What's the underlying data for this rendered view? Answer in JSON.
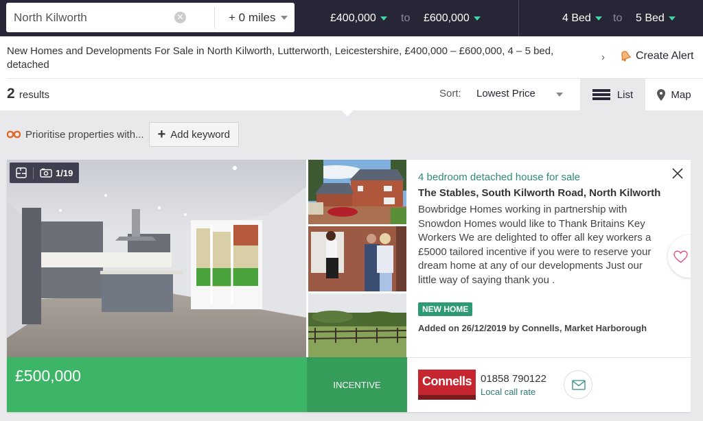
{
  "search": {
    "location_value": "North Kilworth",
    "radius": "+ 0 miles"
  },
  "filters": {
    "min_price": "£400,000",
    "max_price": "£600,000",
    "min_beds": "4 Bed",
    "max_beds": "5 Bed",
    "to_label": "to"
  },
  "header": {
    "page_heading": "New Homes and Developments For Sale in North Kilworth, Lutterworth, Leicestershire, £400,000 – £600,000, 4 – 5 bed, detached",
    "create_alert_label": "Create Alert",
    "results_count": "2",
    "results_label": "results",
    "sort_label": "Sort:",
    "sort_value": "Lowest Price",
    "view_list_label": "List",
    "view_map_label": "Map"
  },
  "keywords": {
    "prompt": "Prioritise properties with...",
    "add_label": "Add keyword"
  },
  "listing": {
    "photo_counter": "1/19",
    "price": "£500,000",
    "incentive_label": "INCENTIVE",
    "property_type": "4 bedroom detached house for sale",
    "address": "The Stables, South Kilworth Road, North Kilworth",
    "description": "Bowbridge Homes working in partnership with Snowdon Homes would like to Thank Britains Key Workers We are delighted to offer all key workers a £5000 tailored incentive if you were to reserve your dream home at any of our developments Just our little way of saying thank you .",
    "tag": "NEW HOME",
    "added_on": "Added on 26/12/2019 by Connells, Market Harborough",
    "agent": {
      "logo_text": "Connells",
      "phone": "01858 790122",
      "call_rate": "Local call rate"
    }
  },
  "colors": {
    "topbar_bg": "#262637",
    "accent_teal": "#3fd6a5",
    "price_green": "#3db567",
    "incentive_green": "#359c59",
    "new_home_tag": "#2e9a73",
    "agent_red": "#c52630"
  }
}
